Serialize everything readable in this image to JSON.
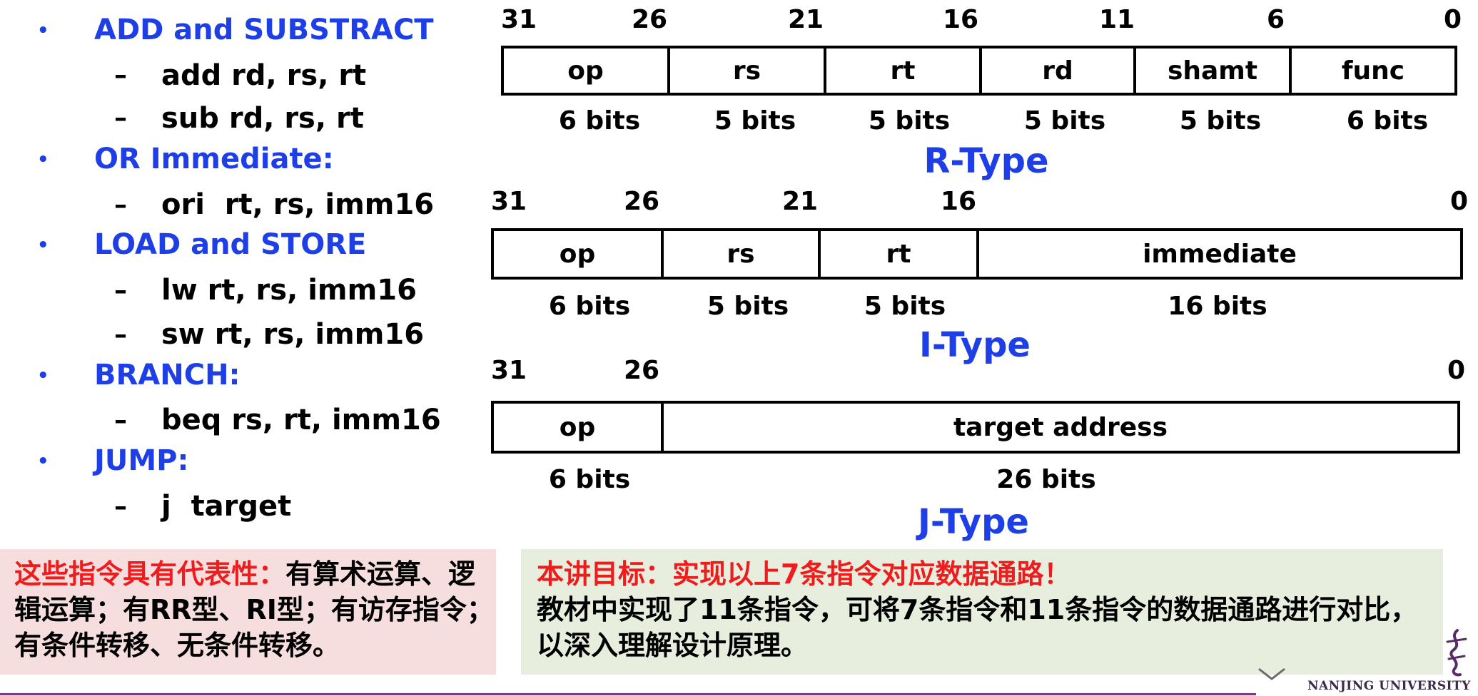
{
  "instructions": {
    "groups": [
      {
        "heading": "ADD and SUBSTRACT",
        "items": [
          "add rd, rs, rt",
          "sub rd, rs, rt"
        ]
      },
      {
        "heading": "OR Immediate:",
        "items": [
          "ori  rt, rs, imm16"
        ]
      },
      {
        "heading": "LOAD and STORE",
        "items": [
          "lw rt, rs, imm16",
          "sw rt, rs, imm16"
        ]
      },
      {
        "heading": "BRANCH:",
        "items": [
          "beq rs, rt, imm16"
        ]
      },
      {
        "heading": "JUMP:",
        "items": [
          "j  target"
        ]
      }
    ],
    "bullet_symbol": "•",
    "dash_symbol": "–"
  },
  "formats": {
    "r_type": {
      "name": "R-Type",
      "bit_labels": [
        "31",
        "26",
        "21",
        "16",
        "11",
        "6",
        "0"
      ],
      "fields": [
        "op",
        "rs",
        "rt",
        "rd",
        "shamt",
        "func"
      ],
      "widths": [
        "6 bits",
        "5 bits",
        "5 bits",
        "5 bits",
        "5 bits",
        "6 bits"
      ]
    },
    "i_type": {
      "name": "I-Type",
      "bit_labels": [
        "31",
        "26",
        "21",
        "16",
        "0"
      ],
      "fields": [
        "op",
        "rs",
        "rt",
        "immediate"
      ],
      "widths": [
        "6 bits",
        "5 bits",
        "5 bits",
        "16 bits"
      ]
    },
    "j_type": {
      "name": "J-Type",
      "bit_labels": [
        "31",
        "26",
        "0"
      ],
      "fields": [
        "op",
        "target address"
      ],
      "widths": [
        "6 bits",
        "26 bits"
      ]
    }
  },
  "notes": {
    "left": {
      "highlight": "这些指令具有代表性：",
      "text": "有算术运算、逻辑运算；有RR型、RI型；有访存指令；有条件转移、无条件转移。"
    },
    "right": {
      "highlight": "本讲目标：实现以上7条指令对应数据通路！",
      "text": "教材中实现了11条指令，可将7条指令和11条指令的数据通路进行对比，以深入理解设计原理。"
    }
  },
  "footer": {
    "logo_text": "NANJING UNIVERSITY"
  },
  "colors": {
    "heading_blue": "#1f3fe6",
    "note_red": "#ee1c1c",
    "note_left_bg": "#f6dede",
    "note_right_bg": "#e8eede",
    "footer_purple": "#7c3a84"
  }
}
